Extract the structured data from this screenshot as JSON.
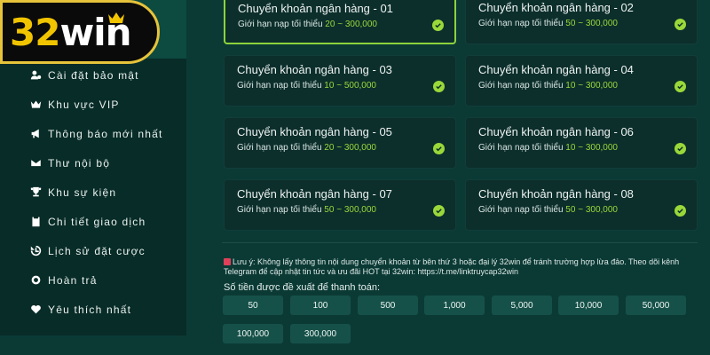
{
  "brand": {
    "logo_num": "32",
    "logo_word": "win"
  },
  "sidebar": {
    "items": [
      {
        "label": "Cài đặt bảo mật",
        "icon": "user-gear-icon"
      },
      {
        "label": "Khu vực VIP",
        "icon": "crown-icon"
      },
      {
        "label": "Thông báo mới nhất",
        "icon": "megaphone-icon"
      },
      {
        "label": "Thư nội bộ",
        "icon": "envelope-icon"
      },
      {
        "label": "Khu sự kiện",
        "icon": "trophy-icon"
      },
      {
        "label": "Chi tiết giao dịch",
        "icon": "clipboard-icon"
      },
      {
        "label": "Lịch sử đặt cược",
        "icon": "history-icon"
      },
      {
        "label": "Hoàn trả",
        "icon": "coin-icon"
      },
      {
        "label": "Yêu thích nhất",
        "icon": "heart-icon"
      }
    ]
  },
  "banks": [
    {
      "title": "Chuyển khoản ngân hàng - 01",
      "limit_label": "Giới hạn nạp tối thiểu",
      "amount": "20 ~ 300,000",
      "selected": true
    },
    {
      "title": "Chuyển khoản ngân hàng - 02",
      "limit_label": "Giới hạn nạp tối thiểu",
      "amount": "50 ~ 300,000",
      "selected": false
    },
    {
      "title": "Chuyển khoản ngân hàng - 03",
      "limit_label": "Giới hạn nạp tối thiểu",
      "amount": "10 ~ 500,000",
      "selected": false
    },
    {
      "title": "Chuyển khoản ngân hàng - 04",
      "limit_label": "Giới hạn nạp tối thiểu",
      "amount": "10 ~ 300,000",
      "selected": false
    },
    {
      "title": "Chuyển khoản ngân hàng - 05",
      "limit_label": "Giới hạn nạp tối thiểu",
      "amount": "20 ~ 300,000",
      "selected": false
    },
    {
      "title": "Chuyển khoản ngân hàng - 06",
      "limit_label": "Giới hạn nạp tối thiểu",
      "amount": "10 ~ 300,000",
      "selected": false
    },
    {
      "title": "Chuyển khoản ngân hàng - 07",
      "limit_label": "Giới hạn nạp tối thiểu",
      "amount": "50 ~ 300,000",
      "selected": false
    },
    {
      "title": "Chuyển khoản ngân hàng - 08",
      "limit_label": "Giới hạn nạp tối thiểu",
      "amount": "50 ~ 300,000",
      "selected": false
    }
  ],
  "note": {
    "text": "Lưu ý: Không lấy thông tin nội dung chuyển khoản từ bên thứ 3 hoặc đại lý 32win để tránh trường hợp lừa đảo. Theo dõi kênh Telegram để cập nhật tin tức và ưu đãi HOT tại 32win: https://t.me/linktruycap32win"
  },
  "amounts": {
    "label": "Số tiền được đề xuất để thanh toán:",
    "options": [
      "50",
      "100",
      "500",
      "1,000",
      "5,000",
      "10,000",
      "50,000",
      "100,000",
      "300,000"
    ]
  },
  "colors": {
    "accent": "#9ad83a",
    "background": "#0b3a35",
    "card": "#0c2f2c",
    "chip": "#165149",
    "logo_gold": "#f1c400"
  }
}
